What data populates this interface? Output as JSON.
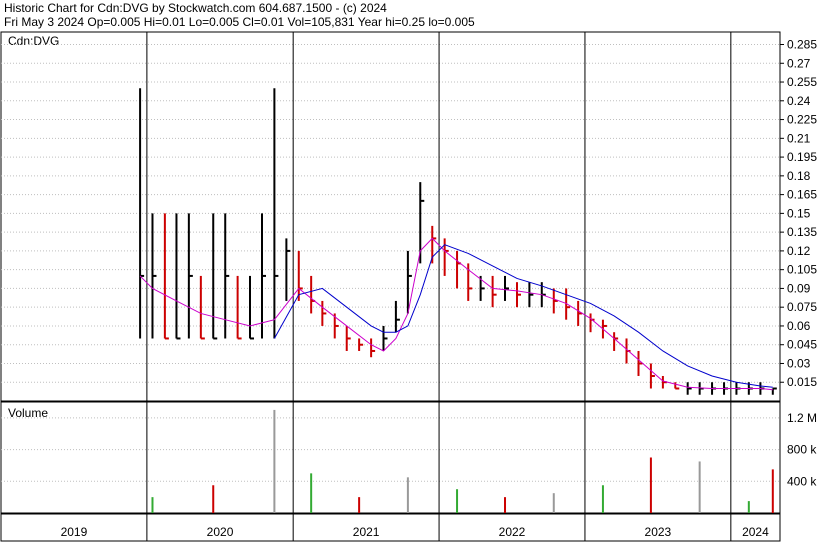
{
  "header": {
    "line1": "Historic Chart for Cdn:DVG by Stockwatch.com 604.687.1500 - (c) 2024",
    "line2": "Fri May  3 2024   Op=0.005   Hi=0.01   Lo=0.005   Cl=0.01   Vol=105,831   Year hi=0.25   lo=0.005"
  },
  "price_panel": {
    "symbol": "Cdn:DVG"
  },
  "volume_panel": {
    "title": "Volume"
  },
  "colors": {
    "up": "#000000",
    "down": "#cc0000",
    "ma_short": "#cc00cc",
    "ma_long": "#0000cc",
    "vol_up": "#33aa33",
    "vol_down": "#cc0000",
    "vol_flat": "#999999",
    "grid": "#bfbfbf"
  },
  "chart_data": [
    {
      "type": "line",
      "title": "Historic Chart for Cdn:DVG",
      "ylabel": "",
      "ylim": [
        0.0,
        0.295
      ],
      "y_ticks": [
        "0.285",
        "0.27",
        "0.255",
        "0.24",
        "0.225",
        "0.21",
        "0.195",
        "0.18",
        "0.165",
        "0.15",
        "0.135",
        "0.12",
        "0.105",
        "0.09",
        "0.075",
        "0.06",
        "0.045",
        "0.03",
        "0.015"
      ],
      "x_ticks": [
        "2019",
        "2020",
        "2021",
        "2022",
        "2023",
        "2024"
      ],
      "series": [
        {
          "kind": "price",
          "points": [
            [
              "2019-12",
              0.1,
              0.05,
              0.25
            ],
            [
              "2020-01",
              0.1,
              0.05,
              0.15
            ],
            [
              "2020-02",
              0.05,
              0.05,
              0.15
            ],
            [
              "2020-03",
              0.05,
              0.05,
              0.15
            ],
            [
              "2020-04",
              0.1,
              0.05,
              0.15
            ],
            [
              "2020-05",
              0.05,
              0.05,
              0.1
            ],
            [
              "2020-06",
              0.05,
              0.05,
              0.15
            ],
            [
              "2020-07",
              0.1,
              0.05,
              0.15
            ],
            [
              "2020-08",
              0.05,
              0.05,
              0.1
            ],
            [
              "2020-09",
              0.05,
              0.05,
              0.1
            ],
            [
              "2020-10",
              0.1,
              0.05,
              0.15
            ],
            [
              "2020-11",
              0.1,
              0.05,
              0.25
            ],
            [
              "2020-12",
              0.12,
              0.08,
              0.13
            ],
            [
              "2021-01",
              0.09,
              0.08,
              0.12
            ],
            [
              "2021-02",
              0.08,
              0.07,
              0.1
            ],
            [
              "2021-03",
              0.07,
              0.06,
              0.08
            ],
            [
              "2021-04",
              0.06,
              0.05,
              0.07
            ],
            [
              "2021-05",
              0.05,
              0.04,
              0.06
            ],
            [
              "2021-06",
              0.045,
              0.04,
              0.05
            ],
            [
              "2021-07",
              0.04,
              0.035,
              0.05
            ],
            [
              "2021-08",
              0.05,
              0.04,
              0.06
            ],
            [
              "2021-09",
              0.065,
              0.055,
              0.08
            ],
            [
              "2021-10",
              0.1,
              0.07,
              0.12
            ],
            [
              "2021-11",
              0.16,
              0.11,
              0.175
            ],
            [
              "2021-12",
              0.13,
              0.11,
              0.14
            ],
            [
              "2022-01",
              0.12,
              0.1,
              0.13
            ],
            [
              "2022-02",
              0.11,
              0.09,
              0.12
            ],
            [
              "2022-03",
              0.09,
              0.08,
              0.11
            ],
            [
              "2022-04",
              0.09,
              0.08,
              0.1
            ],
            [
              "2022-05",
              0.085,
              0.075,
              0.1
            ],
            [
              "2022-06",
              0.09,
              0.08,
              0.1
            ],
            [
              "2022-07",
              0.085,
              0.075,
              0.095
            ],
            [
              "2022-08",
              0.085,
              0.075,
              0.095
            ],
            [
              "2022-09",
              0.085,
              0.075,
              0.095
            ],
            [
              "2022-10",
              0.08,
              0.07,
              0.09
            ],
            [
              "2022-11",
              0.075,
              0.065,
              0.09
            ],
            [
              "2022-12",
              0.07,
              0.06,
              0.08
            ],
            [
              "2023-01",
              0.065,
              0.055,
              0.07
            ],
            [
              "2023-02",
              0.06,
              0.05,
              0.065
            ],
            [
              "2023-03",
              0.05,
              0.04,
              0.055
            ],
            [
              "2023-04",
              0.04,
              0.03,
              0.05
            ],
            [
              "2023-05",
              0.03,
              0.02,
              0.04
            ],
            [
              "2023-06",
              0.02,
              0.01,
              0.03
            ],
            [
              "2023-07",
              0.015,
              0.01,
              0.02
            ],
            [
              "2023-08",
              0.01,
              0.01,
              0.015
            ],
            [
              "2023-09",
              0.01,
              0.005,
              0.015
            ],
            [
              "2023-10",
              0.01,
              0.005,
              0.015
            ],
            [
              "2023-11",
              0.01,
              0.005,
              0.015
            ],
            [
              "2023-12",
              0.01,
              0.005,
              0.015
            ],
            [
              "2024-01",
              0.01,
              0.005,
              0.015
            ],
            [
              "2024-02",
              0.01,
              0.005,
              0.015
            ],
            [
              "2024-03",
              0.01,
              0.005,
              0.015
            ],
            [
              "2024-04",
              0.01,
              0.005,
              0.01
            ]
          ]
        },
        {
          "kind": "ma_short",
          "points": [
            [
              "2019-12",
              0.1
            ],
            [
              "2020-01",
              0.09
            ],
            [
              "2020-03",
              0.08
            ],
            [
              "2020-05",
              0.07
            ],
            [
              "2020-07",
              0.065
            ],
            [
              "2020-09",
              0.06
            ],
            [
              "2020-11",
              0.065
            ],
            [
              "2021-01",
              0.09
            ],
            [
              "2021-03",
              0.075
            ],
            [
              "2021-05",
              0.06
            ],
            [
              "2021-07",
              0.045
            ],
            [
              "2021-08",
              0.04
            ],
            [
              "2021-09",
              0.05
            ],
            [
              "2021-10",
              0.07
            ],
            [
              "2021-11",
              0.12
            ],
            [
              "2021-12",
              0.13
            ],
            [
              "2022-01",
              0.12
            ],
            [
              "2022-03",
              0.105
            ],
            [
              "2022-05",
              0.09
            ],
            [
              "2022-07",
              0.088
            ],
            [
              "2022-09",
              0.085
            ],
            [
              "2022-11",
              0.078
            ],
            [
              "2023-01",
              0.066
            ],
            [
              "2023-03",
              0.05
            ],
            [
              "2023-05",
              0.033
            ],
            [
              "2023-07",
              0.016
            ],
            [
              "2023-09",
              0.011
            ],
            [
              "2023-11",
              0.01
            ],
            [
              "2024-01",
              0.01
            ],
            [
              "2024-03",
              0.01
            ],
            [
              "2024-04",
              0.009
            ]
          ]
        },
        {
          "kind": "ma_long",
          "points": [
            [
              "2020-11",
              0.05
            ],
            [
              "2021-01",
              0.085
            ],
            [
              "2021-03",
              0.09
            ],
            [
              "2021-05",
              0.075
            ],
            [
              "2021-07",
              0.06
            ],
            [
              "2021-08",
              0.055
            ],
            [
              "2021-09",
              0.055
            ],
            [
              "2021-10",
              0.06
            ],
            [
              "2021-11",
              0.085
            ],
            [
              "2021-12",
              0.115
            ],
            [
              "2022-01",
              0.125
            ],
            [
              "2022-03",
              0.118
            ],
            [
              "2022-05",
              0.108
            ],
            [
              "2022-07",
              0.098
            ],
            [
              "2022-09",
              0.092
            ],
            [
              "2022-11",
              0.085
            ],
            [
              "2023-01",
              0.078
            ],
            [
              "2023-03",
              0.068
            ],
            [
              "2023-05",
              0.055
            ],
            [
              "2023-07",
              0.04
            ],
            [
              "2023-09",
              0.028
            ],
            [
              "2023-11",
              0.02
            ],
            [
              "2024-01",
              0.015
            ],
            [
              "2024-03",
              0.012
            ],
            [
              "2024-04",
              0.011
            ]
          ]
        }
      ]
    },
    {
      "type": "bar",
      "title": "Volume",
      "ylim": [
        0,
        1400000
      ],
      "y_ticks": [
        "1.2 M",
        "800 k",
        "400 k"
      ],
      "categories": [
        "2020-01",
        "2020-06",
        "2020-11",
        "2021-02",
        "2021-06",
        "2021-10",
        "2022-02",
        "2022-06",
        "2022-10",
        "2023-02",
        "2023-06",
        "2023-10",
        "2024-02",
        "2024-04"
      ],
      "series": [
        {
          "name": "",
          "values": [
            200000,
            350000,
            1300000,
            500000,
            200000,
            450000,
            300000,
            200000,
            250000,
            350000,
            700000,
            650000,
            150000,
            550000
          ]
        }
      ]
    }
  ]
}
